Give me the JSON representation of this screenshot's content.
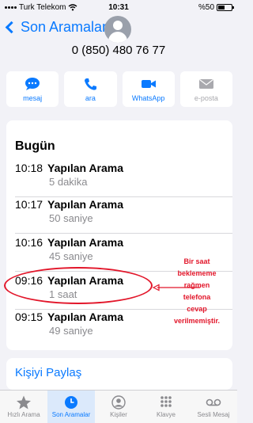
{
  "status_bar": {
    "carrier": "Turk Telekom",
    "time": "10:31",
    "battery": "%50"
  },
  "header": {
    "back_label": "Son Aramalar"
  },
  "contact": {
    "phone": "0 (850) 480 76 77"
  },
  "actions": [
    {
      "label": "mesaj",
      "icon": "message-icon"
    },
    {
      "label": "ara",
      "icon": "phone-icon"
    },
    {
      "label": "WhatsApp",
      "icon": "video-icon"
    },
    {
      "label": "e-posta",
      "icon": "mail-icon"
    }
  ],
  "calls_section": {
    "title": "Bugün",
    "calls": [
      {
        "time": "10:18",
        "type": "Yapılan Arama",
        "duration": "5 dakika"
      },
      {
        "time": "10:17",
        "type": "Yapılan Arama",
        "duration": "50 saniye"
      },
      {
        "time": "10:16",
        "type": "Yapılan Arama",
        "duration": "45 saniye"
      },
      {
        "time": "09:16",
        "type": "Yapılan Arama",
        "duration": "1 saat"
      },
      {
        "time": "09:15",
        "type": "Yapılan Arama",
        "duration": "49 saniye"
      }
    ]
  },
  "annotation": {
    "lines": [
      "Bir saat",
      "beklememe",
      "rağmen",
      "telefona",
      "cevap",
      "verilmemiştir."
    ],
    "color": "#e2162a"
  },
  "share": {
    "label": "Kişiyi Paylaş"
  },
  "tabbar": {
    "tabs": [
      {
        "label": "Hızlı Arama",
        "icon": "star-icon",
        "active": false
      },
      {
        "label": "Son Aramalar",
        "icon": "clock-icon",
        "active": true
      },
      {
        "label": "Kişiler",
        "icon": "person-icon",
        "active": false
      },
      {
        "label": "Klavye",
        "icon": "keypad-icon",
        "active": false
      },
      {
        "label": "Sesli Mesaj",
        "icon": "voicemail-icon",
        "active": false
      }
    ]
  },
  "colors": {
    "accent": "#0a7aff",
    "background": "#f2f2f7",
    "annotation": "#e2162a"
  }
}
